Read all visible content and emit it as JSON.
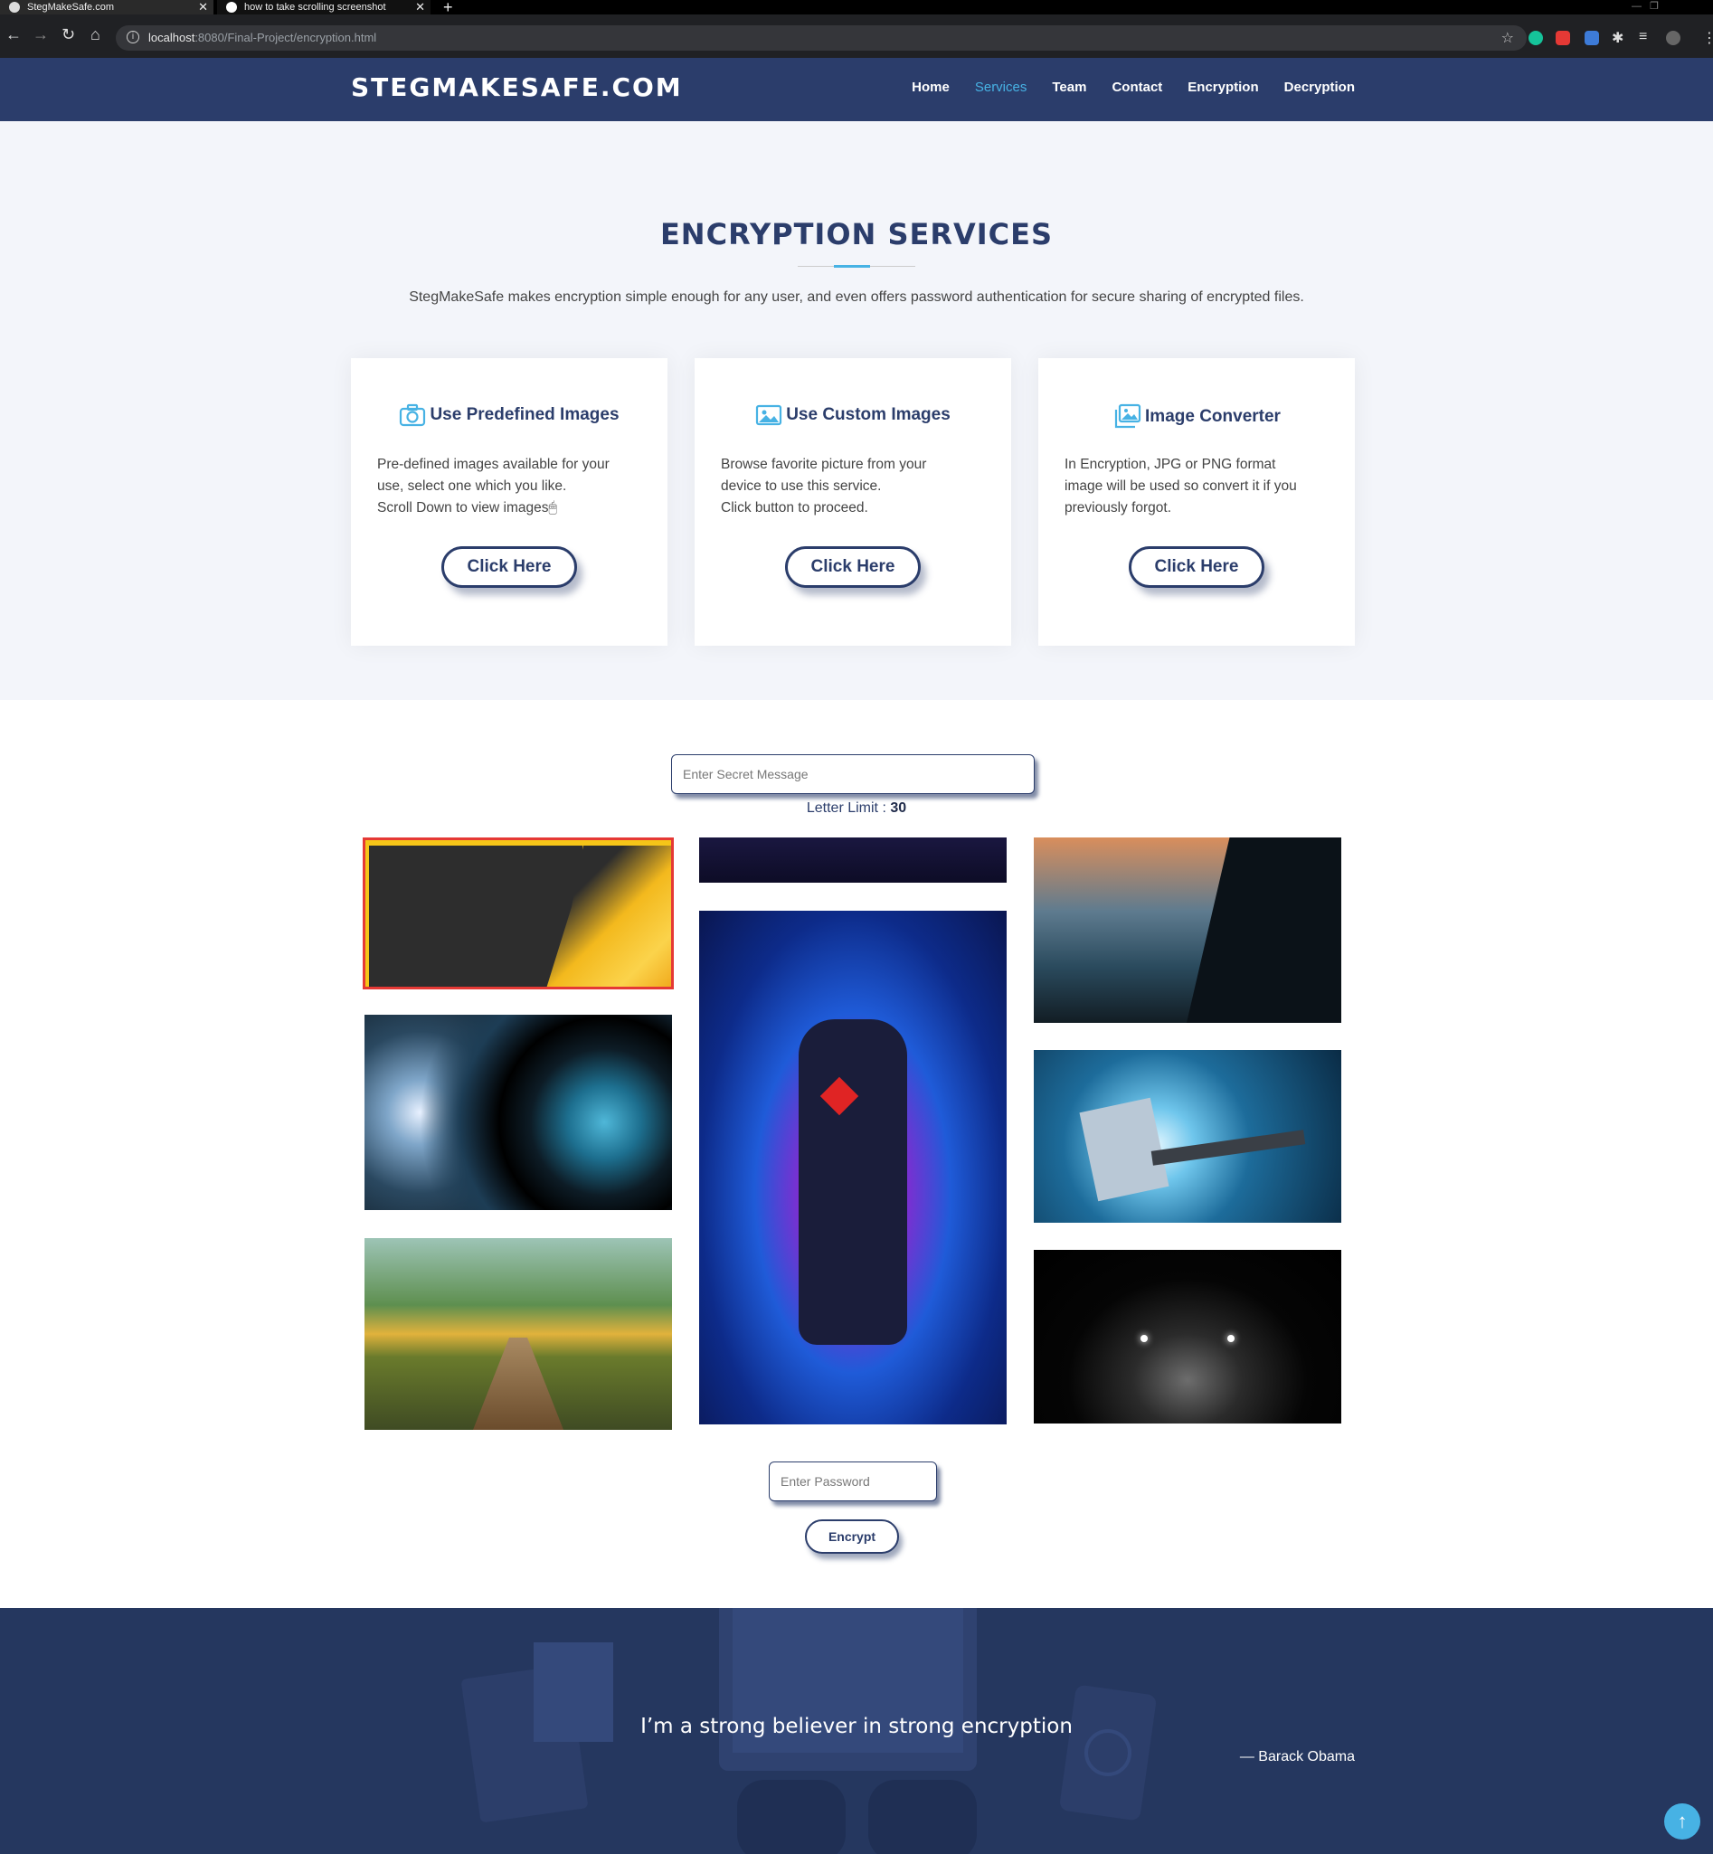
{
  "browser": {
    "tabs": [
      {
        "title": "StegMakeSafe.com"
      },
      {
        "title": "how to take scrolling screenshot"
      }
    ],
    "url_host": "localhost",
    "url_rest": ":8080/Final-Project/encryption.html"
  },
  "header": {
    "logo": "STEGMAKESAFE.COM",
    "nav": [
      "Home",
      "Services",
      "Team",
      "Contact",
      "Encryption",
      "Decryption"
    ],
    "active_nav": "Services"
  },
  "services": {
    "title": "ENCRYPTION SERVICES",
    "description": "StegMakeSafe makes encryption simple enough for any user, and even offers password authentication for secure sharing of encrypted files.",
    "cards": [
      {
        "icon": "camera-icon",
        "title": "Use Predefined Images",
        "lines": [
          "Pre-defined images available for your",
          "use, select one which you like.",
          "Scroll Down to view images🖱"
        ],
        "button": "Click Here"
      },
      {
        "icon": "image-icon",
        "title": "Use Custom Images",
        "lines": [
          "Browse favorite picture from your",
          "device to use this service.",
          "Click button to proceed."
        ],
        "button": "Click Here"
      },
      {
        "icon": "images-icon",
        "title": "Image Converter",
        "lines": [
          "In Encryption, JPG or PNG format",
          "image will be used so convert it if you",
          "previously forgot."
        ],
        "button": "Click Here"
      }
    ]
  },
  "encrypt_form": {
    "secret_placeholder": "Enter Secret Message",
    "letter_limit_label": "Letter Limit : ",
    "letter_limit_value": "30",
    "password_placeholder": "Enter Password",
    "encrypt_button": "Encrypt"
  },
  "gallery": {
    "images": [
      "yellow-mountain-wallpaper",
      "camera-lens",
      "wooden-bridge-landscape",
      "space-banner",
      "spiderman-space",
      "hooded-figure-landscape",
      "thor-hammer",
      "car-headlights-dark"
    ],
    "selected": "yellow-mountain-wallpaper"
  },
  "quote": {
    "text": "I’m a strong believer in strong encryption",
    "author": "— Barack Obama"
  },
  "colors": {
    "brand_navy": "#2b3d6b",
    "accent_blue": "#47b2e4",
    "selection_red": "#e53935"
  }
}
